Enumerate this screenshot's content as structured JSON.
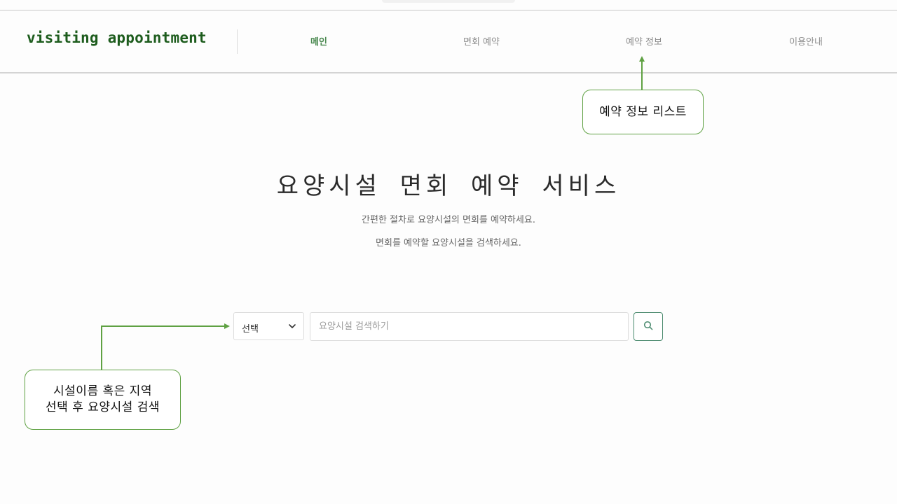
{
  "header": {
    "logo": "visiting appointment",
    "nav": [
      {
        "label": "메인",
        "active": true
      },
      {
        "label": "면회 예약",
        "active": false
      },
      {
        "label": "예약 정보",
        "active": false
      },
      {
        "label": "이용안내",
        "active": false
      }
    ]
  },
  "annotations": {
    "reservation_list": "예약 정보 리스트",
    "search_hint_line1": "시설이름 혹은 지역",
    "search_hint_line2": "선택 후 요양시설 검색"
  },
  "hero": {
    "title": "요양시설 면회 예약 서비스",
    "subtitle1": "간편한 절차로 요양시설의 면회를 예약하세요.",
    "subtitle2": "면회를 예약할 요양시설을 검색하세요."
  },
  "search": {
    "select_value": "선택",
    "placeholder": "요양시설 검색하기",
    "value": "",
    "button_icon": "search-icon"
  },
  "colors": {
    "logo": "#1d5c1d",
    "nav_active": "#4c8a52",
    "annotation": "#5fa143",
    "search_button_border": "#4a8a6e"
  }
}
